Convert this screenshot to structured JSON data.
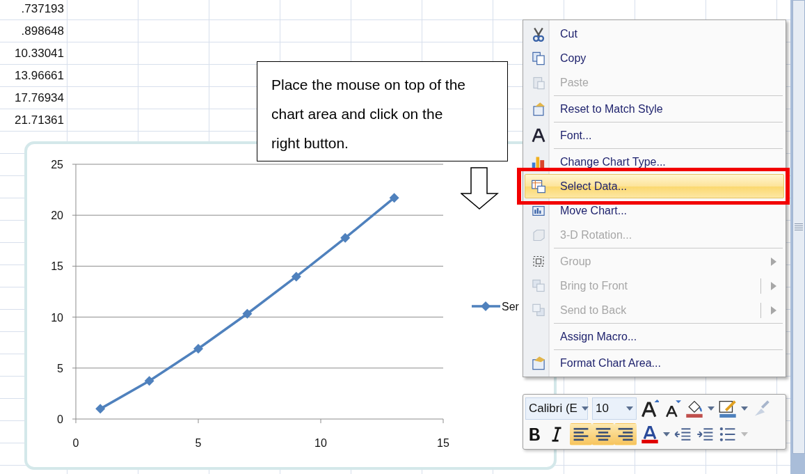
{
  "sheet": {
    "cells": [
      ".737193",
      ".898648",
      "10.33041",
      "13.96661",
      "17.76934",
      "21.71361"
    ]
  },
  "chart": {
    "chart_data": {
      "type": "line",
      "grid": true,
      "x": [
        1,
        3,
        5,
        7,
        9,
        11,
        13
      ],
      "series": [
        {
          "name": "Ser",
          "color": "#4f81bd",
          "marker": "diamond",
          "values": [
            1,
            3.74,
            6.9,
            10.33,
            13.97,
            17.77,
            21.71
          ]
        }
      ],
      "xlim": [
        0,
        15
      ],
      "ylim": [
        0,
        25
      ],
      "xticks": [
        0,
        5,
        10,
        15
      ],
      "yticks": [
        0,
        5,
        10,
        15,
        20,
        25
      ]
    }
  },
  "callout": {
    "text": "Place the mouse on top of the chart area and click on the right button."
  },
  "context_menu": {
    "items": [
      {
        "label": "Cut",
        "disabled": false,
        "selected": false
      },
      {
        "label": "Copy",
        "disabled": false,
        "selected": false
      },
      {
        "label": "Paste",
        "disabled": true,
        "selected": false
      },
      {
        "label": "Reset to Match Style",
        "disabled": false,
        "selected": false,
        "separator_before": true
      },
      {
        "label": "Font...",
        "disabled": false,
        "selected": false,
        "separator_before": true
      },
      {
        "label": "Change Chart Type...",
        "disabled": false,
        "selected": false,
        "separator_before": true
      },
      {
        "label": "Select Data...",
        "disabled": false,
        "selected": true
      },
      {
        "label": "Move Chart...",
        "disabled": false,
        "selected": false
      },
      {
        "label": "3-D Rotation...",
        "disabled": true,
        "selected": false
      },
      {
        "label": "Group",
        "disabled": true,
        "selected": false,
        "separator_before": true,
        "submenu": true
      },
      {
        "label": "Bring to Front",
        "disabled": true,
        "selected": false,
        "submenu": true,
        "split": true
      },
      {
        "label": "Send to Back",
        "disabled": true,
        "selected": false,
        "submenu": true,
        "split": true
      },
      {
        "label": "Assign Macro...",
        "disabled": false,
        "selected": false,
        "separator_before": true
      },
      {
        "label": "Format Chart Area...",
        "disabled": false,
        "selected": false,
        "separator_before": true
      }
    ]
  },
  "mini_toolbar": {
    "font": "Calibri (E",
    "size": "10",
    "align_buttons": [
      {
        "pressed": true
      },
      {
        "pressed": true
      },
      {
        "pressed": true
      }
    ]
  }
}
